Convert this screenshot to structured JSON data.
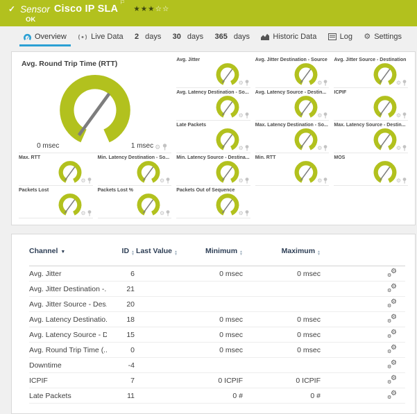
{
  "colors": {
    "brand_green": "#b2c11e",
    "active_tab_blue": "#2ba0d4",
    "needle_gray": "#7d7d7d"
  },
  "header": {
    "type_label": "Sensor",
    "title": "Cisco IP SLA",
    "stars_filled": "★★★",
    "stars_empty": "☆☆",
    "status": "OK"
  },
  "tabs": {
    "overview": "Overview",
    "live_data": "Live Data",
    "d2_num": "2",
    "d2_label": "days",
    "d30_num": "30",
    "d30_label": "days",
    "d365_num": "365",
    "d365_label": "days",
    "historic": "Historic Data",
    "log": "Log",
    "settings": "Settings"
  },
  "gauges": {
    "main": {
      "title": "Avg. Round Trip Time (RTT)",
      "scale_min": "0 msec",
      "scale_max": "1 msec"
    },
    "small": [
      {
        "title": "Avg. Jitter"
      },
      {
        "title": "Avg. Jitter Destination - Source"
      },
      {
        "title": "Avg. Jitter Source - Destination"
      },
      {
        "title": "Avg. Latency Destination - So..."
      },
      {
        "title": "Avg. Latency Source - Destin..."
      },
      {
        "title": "ICPIF"
      },
      {
        "title": "Late Packets"
      },
      {
        "title": "Max. Latency Destination - So..."
      },
      {
        "title": "Max. Latency Source - Destin..."
      },
      {
        "title": "Max. RTT"
      },
      {
        "title": "Min. Latency Destination - So..."
      },
      {
        "title": "Min. Latency Source - Destina..."
      },
      {
        "title": "Min. RTT"
      },
      {
        "title": "MOS"
      },
      {
        "title": "Packets Lost"
      },
      {
        "title": "Packets Lost %"
      },
      {
        "title": "Packets Out of Sequence"
      }
    ]
  },
  "table": {
    "headers": {
      "channel": "Channel",
      "id": "ID",
      "last_value": "Last Value",
      "minimum": "Minimum",
      "maximum": "Maximum"
    },
    "rows": [
      {
        "channel": "Avg. Jitter",
        "id": "6",
        "last_value": "",
        "minimum": "0 msec",
        "maximum": "0 msec"
      },
      {
        "channel": "Avg. Jitter Destination -...",
        "id": "21",
        "last_value": "",
        "minimum": "",
        "maximum": ""
      },
      {
        "channel": "Avg. Jitter Source - Des...",
        "id": "20",
        "last_value": "",
        "minimum": "",
        "maximum": ""
      },
      {
        "channel": "Avg. Latency Destinatio...",
        "id": "18",
        "last_value": "",
        "minimum": "0 msec",
        "maximum": "0 msec"
      },
      {
        "channel": "Avg. Latency Source - D...",
        "id": "15",
        "last_value": "",
        "minimum": "0 msec",
        "maximum": "0 msec"
      },
      {
        "channel": "Avg. Round Trip Time (...",
        "id": "0",
        "last_value": "",
        "minimum": "0 msec",
        "maximum": "0 msec"
      },
      {
        "channel": "Downtime",
        "id": "-4",
        "last_value": "",
        "minimum": "",
        "maximum": ""
      },
      {
        "channel": "ICPIF",
        "id": "7",
        "last_value": "",
        "minimum": "0 ICPIF",
        "maximum": "0 ICPIF"
      },
      {
        "channel": "Late Packets",
        "id": "11",
        "last_value": "",
        "minimum": "0 #",
        "maximum": "0 #"
      }
    ]
  }
}
